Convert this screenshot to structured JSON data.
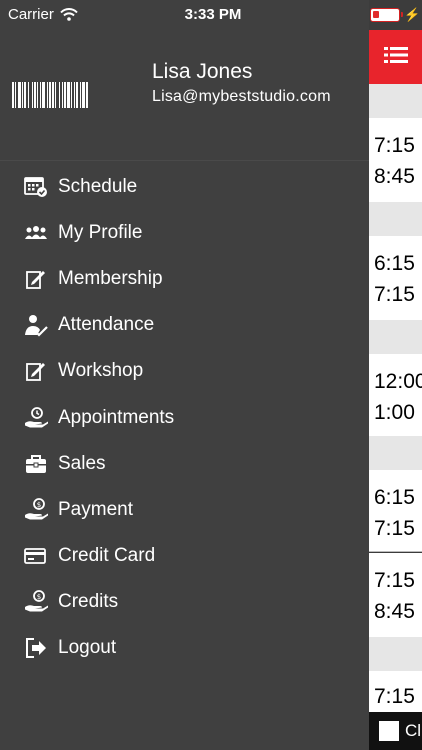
{
  "status_bar": {
    "carrier": "Carrier",
    "time": "3:33 PM",
    "battery_color": "#e12b2b"
  },
  "profile": {
    "name": "Lisa Jones",
    "email": "Lisa@mybeststudio.com",
    "barcode_icon": "barcode-icon"
  },
  "menu": {
    "items": [
      {
        "label": "Schedule",
        "icon": "calendar-check-icon"
      },
      {
        "label": "My Profile",
        "icon": "people-icon"
      },
      {
        "label": "Membership",
        "icon": "edit-note-icon"
      },
      {
        "label": "Attendance",
        "icon": "person-check-icon"
      },
      {
        "label": "Workshop",
        "icon": "edit-note-icon"
      },
      {
        "label": "Appointments",
        "icon": "clock-hand-icon"
      },
      {
        "label": "Sales",
        "icon": "briefcase-icon"
      },
      {
        "label": "Payment",
        "icon": "money-hand-icon"
      },
      {
        "label": "Credit Card",
        "icon": "credit-card-icon"
      },
      {
        "label": "Credits",
        "icon": "money-hand-icon"
      },
      {
        "label": "Logout",
        "icon": "logout-icon"
      }
    ]
  },
  "background": {
    "header_color": "#e8242c",
    "menu_icon": "list-icon",
    "slots": [
      {
        "start": "7:15",
        "end": "8:45"
      },
      {
        "start": "6:15",
        "end": "7:15"
      },
      {
        "start": "12:00",
        "end": "1:00"
      },
      {
        "start": "6:15",
        "end": "7:15"
      },
      {
        "start": "7:15",
        "end": "8:45"
      },
      {
        "start": "7:15",
        "end": ""
      }
    ],
    "bottom_text": "Cl"
  }
}
